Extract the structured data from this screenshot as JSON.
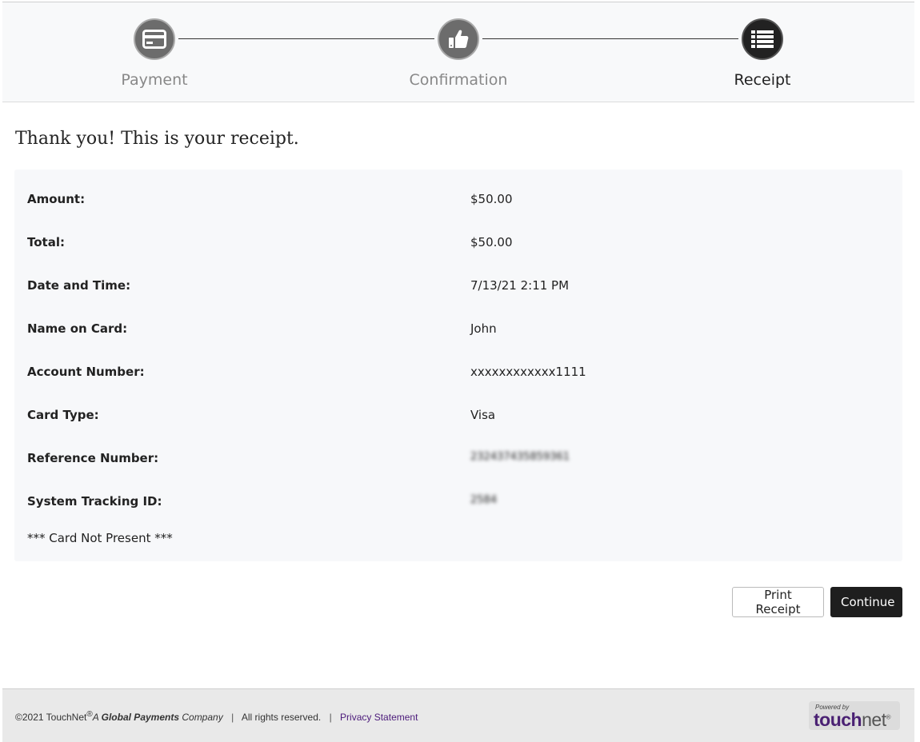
{
  "stepper": {
    "steps": [
      {
        "label": "Payment",
        "icon": "credit-card-icon",
        "state": "complete"
      },
      {
        "label": "Confirmation",
        "icon": "thumbs-up-icon",
        "state": "complete"
      },
      {
        "label": "Receipt",
        "icon": "list-icon",
        "state": "active"
      }
    ]
  },
  "receipt": {
    "title": "Thank you! This is your receipt.",
    "rows": [
      {
        "label": "Amount:",
        "value": "$50.00"
      },
      {
        "label": "Total:",
        "value": "$50.00"
      },
      {
        "label": "Date and Time:",
        "value": "7/13/21 2:11 PM"
      },
      {
        "label": "Name on Card:",
        "value": "John"
      },
      {
        "label": "Account Number:",
        "value": "xxxxxxxxxxxx1111"
      },
      {
        "label": "Card Type:",
        "value": "Visa"
      },
      {
        "label": "Reference Number:",
        "value": "232437435859361"
      },
      {
        "label": "System Tracking ID:",
        "value": "2584"
      }
    ],
    "note": "*** Card Not Present ***"
  },
  "actions": {
    "print_label": "Print Receipt",
    "continue_label": "Continue"
  },
  "footer": {
    "copyright": "©2021 TouchNet",
    "registered": "®",
    "tagline_a": "A ",
    "tagline_global": "Global Payments",
    "tagline_company": " Company",
    "sep": "|",
    "rights": "All rights reserved.",
    "privacy": "Privacy Statement",
    "powered_by": "Powered by",
    "brand_touch": "touch",
    "brand_net": "net",
    "brand_reg": "®"
  },
  "colors": {
    "accent_dark": "#1e1e1e",
    "brand_purple": "#4a2173",
    "panel_bg": "#f7f8fa"
  }
}
